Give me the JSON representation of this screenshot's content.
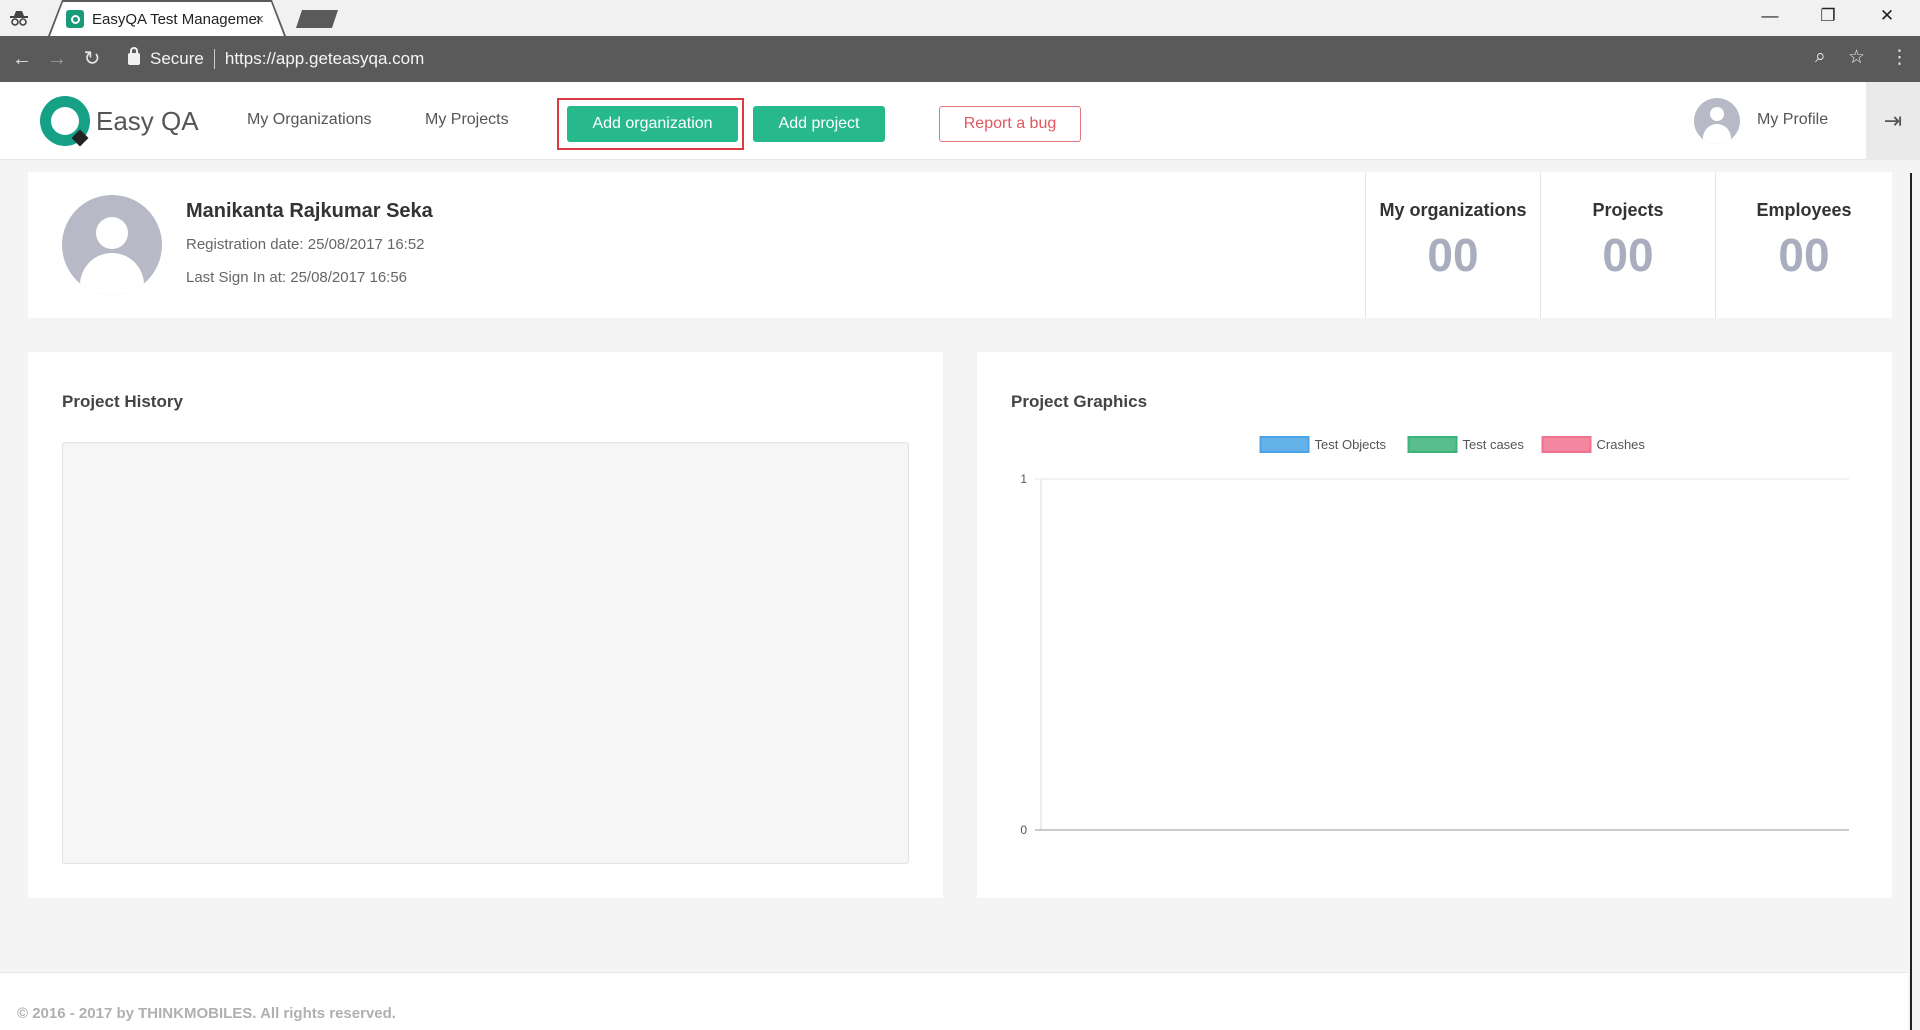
{
  "browser": {
    "tab_title": "EasyQA Test Management",
    "tab_close": "×",
    "secure_label": "Secure",
    "url": "https://app.geteasyqa.com",
    "icons": [
      "incognito-icon",
      "back-icon",
      "forward-icon",
      "reload-icon",
      "lock-icon",
      "zoom-icon",
      "star-icon",
      "menu-icon"
    ],
    "window_controls": {
      "minimize": "—",
      "restore": "❐",
      "close": "✕"
    },
    "nav": {
      "back": "←",
      "forward": "→",
      "reload": "↻",
      "zoom": "⌕",
      "star": "☆",
      "menu": "⋮"
    }
  },
  "header": {
    "logo_text": "Easy QA",
    "nav": [
      {
        "label": "My Organizations"
      },
      {
        "label": "My Projects"
      }
    ],
    "add_organization": "Add organization",
    "add_project": "Add project",
    "report_bug": "Report a bug",
    "profile_label": "My Profile",
    "logout_icon": "⇥"
  },
  "profile": {
    "name": "Manikanta Rajkumar Seka",
    "registration": "Registration date: 25/08/2017 16:52",
    "last_sign_in": "Last Sign In at: 25/08/2017 16:56",
    "stats": [
      {
        "label": "My organizations",
        "value": "00"
      },
      {
        "label": "Projects",
        "value": "00"
      },
      {
        "label": "Employees",
        "value": "00"
      }
    ]
  },
  "history": {
    "title": "Project History"
  },
  "graphics": {
    "title": "Project Graphics"
  },
  "chart_data": {
    "type": "line",
    "title": "",
    "xlabel": "",
    "ylabel": "",
    "ylim": [
      0,
      1
    ],
    "y_ticks": [
      "0",
      "1"
    ],
    "x": [],
    "grid": true,
    "legend_position": "top",
    "series": [
      {
        "name": "Test Objects",
        "color": "#4aa3e6",
        "values": []
      },
      {
        "name": "Test cases",
        "color": "#3cb37a",
        "values": []
      },
      {
        "name": "Crashes",
        "color": "#f0728e",
        "values": []
      }
    ]
  },
  "colors": {
    "accent_green": "#27b98b",
    "highlight_red": "#d9393f",
    "bug_red": "#e0585c",
    "stat_gray": "#a9adbd"
  },
  "footer": {
    "text": "© 2016 - 2017 by THINKMOBILES. All rights reserved."
  }
}
